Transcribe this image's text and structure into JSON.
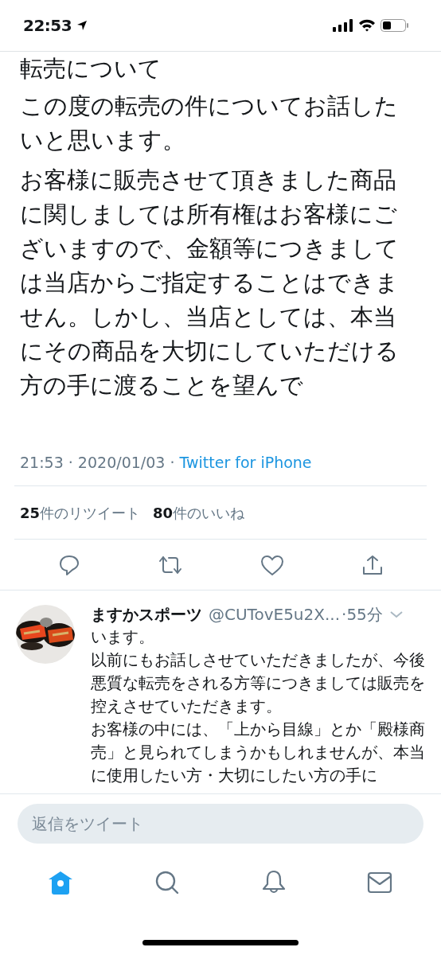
{
  "status_bar": {
    "time": "22:53"
  },
  "tweet": {
    "paragraphs": [
      "転売について",
      "この度の転売の件についてお話したいと思います。",
      "お客様に販売させて頂きました商品に関しましては所有権はお客様にございますので、金額等につきましては当店からご指定することはできません。しかし、当店としては、本当にその商品を大切にしていただける方の手に渡ることを望んで"
    ],
    "time": "21:53 · 2020/01/03 ·",
    "source": "Twitter for iPhone",
    "retweets": {
      "count": "25",
      "label": "件のリツイート"
    },
    "likes": {
      "count": "80",
      "label": "件のいいね"
    }
  },
  "reply": {
    "name": "ますかスポーツ",
    "handle": "@CUTovE5u2X...",
    "age": "·55分",
    "paragraphs": [
      "います。",
      "以前にもお話しさせていただきましたが、今後悪質な転売をされる方等につきましては販売を控えさせていただきます。",
      "お客様の中には、「上から目線」とか「殿様商売」と見られてしまうかもしれませんが、本当に使用したい方・大切にしたい方の手に"
    ]
  },
  "compose": {
    "placeholder": "返信をツイート"
  },
  "tabs": [
    {
      "kind": "home",
      "selected": true
    },
    {
      "kind": "search",
      "selected": false
    },
    {
      "kind": "bell",
      "selected": false
    },
    {
      "kind": "mail",
      "selected": false
    }
  ]
}
